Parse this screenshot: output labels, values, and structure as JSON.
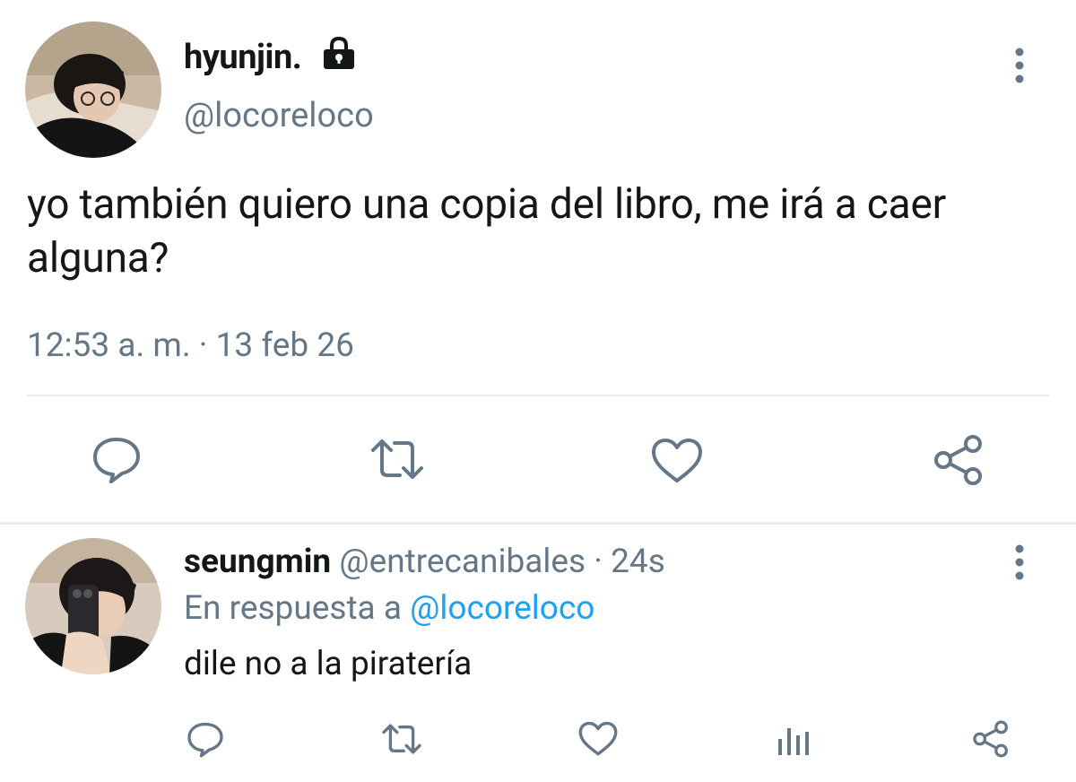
{
  "tweet": {
    "display_name": "hyunjin.",
    "handle": "@locoreloco",
    "text": "yo también quiero una copia del libro, me irá a caer alguna?",
    "timestamp": "12:53 a. m. · 13 feb 26",
    "actions": [
      "reply-icon",
      "retweet-icon",
      "like-icon",
      "share-icon"
    ]
  },
  "reply": {
    "display_name": "seungmin",
    "handle": "@entrecanibales",
    "separator": " · ",
    "time": "24s",
    "replying_prefix": "En respuesta a ",
    "replying_to": "@locoreloco",
    "text": "dile no a la piratería",
    "actions": [
      "reply-icon",
      "retweet-icon",
      "like-icon",
      "analytics-icon",
      "share-icon"
    ]
  },
  "colors": {
    "primary_text": "#14171a",
    "secondary_text": "#657786",
    "link": "#1da1f2",
    "divider": "#e6ecf0"
  }
}
